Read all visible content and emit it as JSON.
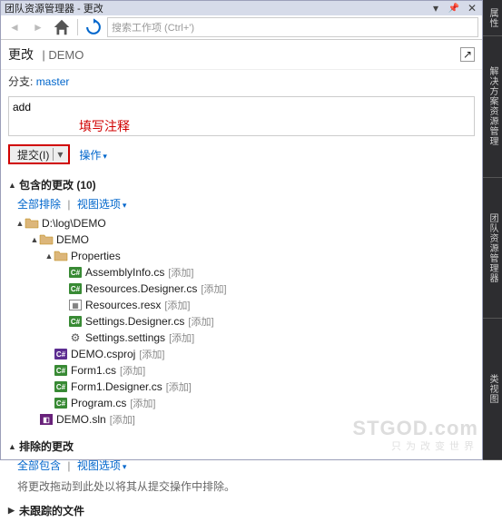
{
  "titlebar": {
    "text": "团队资源管理器 - 更改"
  },
  "toolbar": {
    "search_placeholder": "搜索工作项 (Ctrl+')"
  },
  "header": {
    "label": "更改",
    "project": "| DEMO"
  },
  "branch": {
    "prefix": "分支:",
    "name": "master"
  },
  "commit": {
    "value": "add",
    "annotation": "填写注释",
    "button": "提交(I)",
    "actions": "操作"
  },
  "sections": {
    "included": {
      "title": "包含的更改 (10)",
      "all_exclude": "全部排除",
      "view_options": "视图选项"
    },
    "excluded": {
      "title": "排除的更改",
      "all_include": "全部包含",
      "view_options": "视图选项",
      "desc": "将更改拖动到此处以将其从提交操作中排除。"
    },
    "untracked": {
      "title": "未跟踪的文件"
    }
  },
  "tree": {
    "root": "D:\\log\\DEMO",
    "nodes": [
      {
        "depth": 1,
        "expand": "▲",
        "icon": "folder",
        "name": "DEMO",
        "tag": ""
      },
      {
        "depth": 2,
        "expand": "▲",
        "icon": "folder",
        "name": "Properties",
        "tag": ""
      },
      {
        "depth": 3,
        "expand": "",
        "icon": "cs",
        "name": "AssemblyInfo.cs",
        "tag": "[添加]"
      },
      {
        "depth": 3,
        "expand": "",
        "icon": "cs",
        "name": "Resources.Designer.cs",
        "tag": "[添加]"
      },
      {
        "depth": 3,
        "expand": "",
        "icon": "resx",
        "name": "Resources.resx",
        "tag": "[添加]"
      },
      {
        "depth": 3,
        "expand": "",
        "icon": "cs",
        "name": "Settings.Designer.cs",
        "tag": "[添加]"
      },
      {
        "depth": 3,
        "expand": "",
        "icon": "cog",
        "name": "Settings.settings",
        "tag": "[添加]"
      },
      {
        "depth": 2,
        "expand": "",
        "icon": "csproj",
        "name": "DEMO.csproj",
        "tag": "[添加]"
      },
      {
        "depth": 2,
        "expand": "",
        "icon": "cs",
        "name": "Form1.cs",
        "tag": "[添加]"
      },
      {
        "depth": 2,
        "expand": "",
        "icon": "cs",
        "name": "Form1.Designer.cs",
        "tag": "[添加]"
      },
      {
        "depth": 2,
        "expand": "",
        "icon": "cs",
        "name": "Program.cs",
        "tag": "[添加]"
      },
      {
        "depth": 1,
        "expand": "",
        "icon": "sln",
        "name": "DEMO.sln",
        "tag": "[添加]"
      }
    ]
  },
  "watermark": {
    "main": "STGOD.com",
    "sub": "只为改变世界"
  },
  "rail": [
    "属性",
    "解决方案资源管理",
    "团队资源管理器",
    "类视图"
  ]
}
